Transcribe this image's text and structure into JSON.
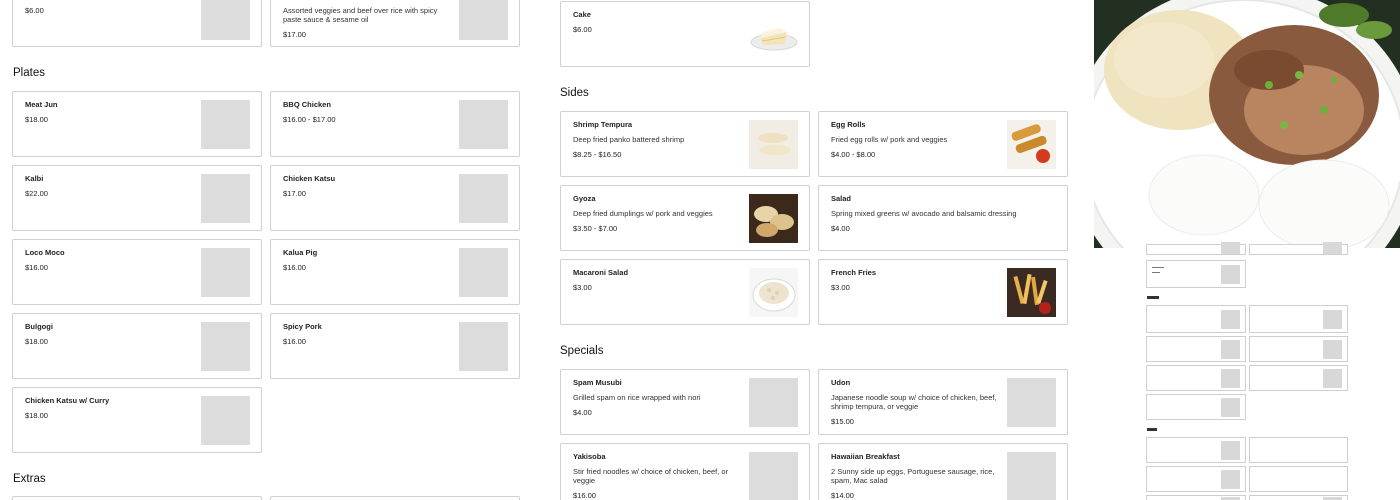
{
  "top_cards": [
    {
      "name": "",
      "desc": "",
      "price": "$6.00"
    },
    {
      "name": "",
      "desc": "Assorted veggies and beef over rice with spicy paste sauce & sesame oil",
      "price": "$17.00"
    }
  ],
  "plates": {
    "heading": "Plates",
    "items": [
      {
        "name": "Meat Jun",
        "price": "$18.00"
      },
      {
        "name": "BBQ Chicken",
        "price": "$16.00 - $17.00"
      },
      {
        "name": "Kalbi",
        "price": "$22.00"
      },
      {
        "name": "Chicken Katsu",
        "price": "$17.00"
      },
      {
        "name": "Loco Moco",
        "price": "$16.00"
      },
      {
        "name": "Kalua Pig",
        "price": "$16.00"
      },
      {
        "name": "Bulgogi",
        "price": "$18.00"
      },
      {
        "name": "Spicy Pork",
        "price": "$16.00"
      },
      {
        "name": "Chicken Katsu w/ Curry",
        "price": "$18.00"
      }
    ]
  },
  "extras": {
    "heading": "Extras"
  },
  "cake": {
    "name": "Cake",
    "price": "$6.00"
  },
  "sides": {
    "heading": "Sides",
    "items": [
      {
        "name": "Shrimp Tempura",
        "desc": "Deep fried panko battered shrimp",
        "price": "$8.25 - $16.50"
      },
      {
        "name": "Egg Rolls",
        "desc": "Fried egg rolls w/ pork and veggies",
        "price": "$4.00 - $8.00"
      },
      {
        "name": "Gyoza",
        "desc": "Deep fried dumplings w/ pork and veggies",
        "price": "$3.50 - $7.00"
      },
      {
        "name": "Salad",
        "desc": "Spring mixed greens w/ avocado and balsamic dressing",
        "price": "$4.00"
      },
      {
        "name": "Macaroni Salad",
        "desc": "",
        "price": "$3.00"
      },
      {
        "name": "French Fries",
        "desc": "",
        "price": "$3.00"
      }
    ]
  },
  "specials": {
    "heading": "Specials",
    "items": [
      {
        "name": "Spam Musubi",
        "desc": "Grilled spam on rice wrapped with nori",
        "price": "$4.00"
      },
      {
        "name": "Udon",
        "desc": "Japanese noodle soup w/ choice of chicken, beef, shrimp tempura, or veggie",
        "price": "$15.00"
      },
      {
        "name": "Yakisoba",
        "desc": "Stir fried noodles w/ choice of chicken, beef, or veggie",
        "price": "$16.00"
      },
      {
        "name": "Hawaiian Breakfast",
        "desc": "2 Sunny side up eggs, Portuguese sausage, rice, spam, Mac salad",
        "price": "$14.00"
      }
    ]
  },
  "colors": {
    "border": "#d0d0d0",
    "placeholder": "#dcdcdc",
    "text": "#222222"
  }
}
